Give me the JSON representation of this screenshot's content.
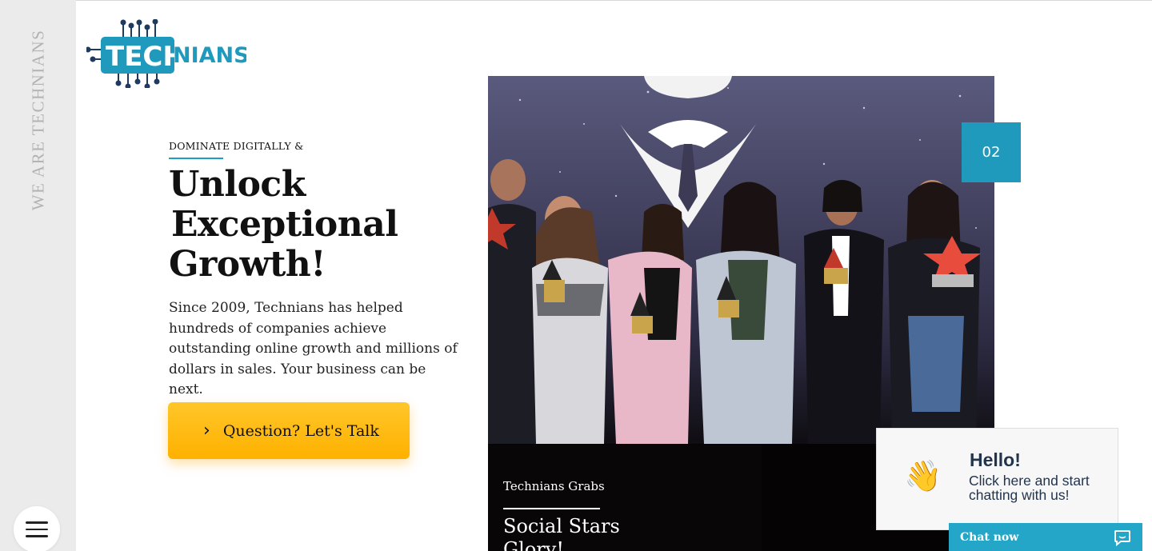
{
  "brand": {
    "logo_text": "TECHNIANS",
    "rail_text": "WE ARE TECHNIANS",
    "accent": "#1f9abc",
    "cta_color": "#ffb800"
  },
  "hero": {
    "eyebrow": "DOMINATE DIGITALLY &",
    "headline_line1": "Unlock",
    "headline_line2": "Exceptional",
    "headline_line3": "Growth!",
    "body": "Since 2009, Technians has helped hundreds of companies achieve outstanding online growth and millions of dollars in sales. Your business can be next.",
    "cta_label": "Question? Let's Talk",
    "cta_icon": "chevron-right-icon"
  },
  "slide": {
    "number": "02",
    "caption_small": "Technians Grabs",
    "caption_large": "Social Stars",
    "caption_large_cont": "Glory!"
  },
  "chat": {
    "hello": "Hello!",
    "message": "Click here and start chatting with us!",
    "bar_label": "Chat now",
    "icon": "chat-bubble-icon"
  },
  "menu": {
    "icon": "hamburger-menu-icon"
  }
}
